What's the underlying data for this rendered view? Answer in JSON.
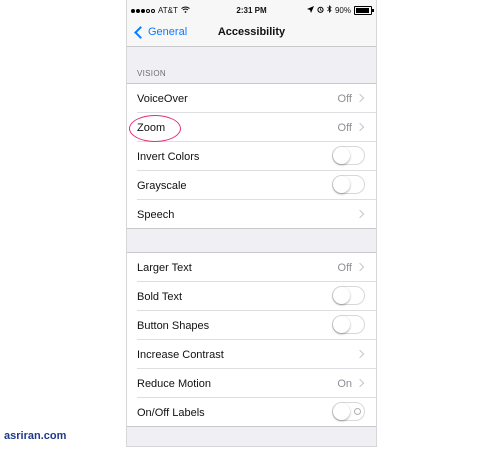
{
  "status": {
    "carrier": "AT&T",
    "time": "2:31 PM",
    "battery": "90%"
  },
  "nav": {
    "back_label": "General",
    "title": "Accessibility"
  },
  "vision_header": "VISION",
  "group1": [
    {
      "label": "VoiceOver",
      "value": "Off",
      "type": "link"
    },
    {
      "label": "Zoom",
      "value": "Off",
      "type": "link"
    },
    {
      "label": "Invert Colors",
      "type": "toggle",
      "on": false
    },
    {
      "label": "Grayscale",
      "type": "toggle",
      "on": false
    },
    {
      "label": "Speech",
      "type": "link"
    }
  ],
  "group2": [
    {
      "label": "Larger Text",
      "value": "Off",
      "type": "link"
    },
    {
      "label": "Bold Text",
      "type": "toggle",
      "on": false
    },
    {
      "label": "Button Shapes",
      "type": "toggle",
      "on": false
    },
    {
      "label": "Increase Contrast",
      "type": "link"
    },
    {
      "label": "Reduce Motion",
      "value": "On",
      "type": "link"
    },
    {
      "label": "On/Off Labels",
      "type": "toggle",
      "on": false
    }
  ],
  "watermark": "asriran.com",
  "colors": {
    "accent": "#0a7aff",
    "highlight_circle": "#e0307a",
    "watermark": "#1f3a8a"
  }
}
